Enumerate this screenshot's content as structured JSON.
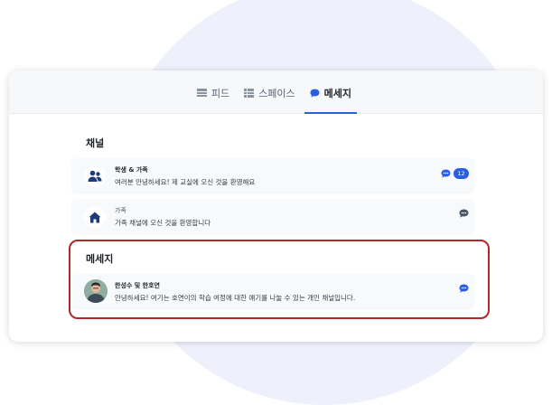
{
  "tabs": [
    {
      "label": "피드",
      "icon": "feed-icon"
    },
    {
      "label": "스페이스",
      "icon": "spaces-icon"
    },
    {
      "label": "메세지",
      "icon": "message-icon",
      "active": true
    }
  ],
  "channels": {
    "title": "채널",
    "items": [
      {
        "title": "학생 & 가족",
        "subtitle": "여러분 안녕하세요! 제 교실에 오신 것을 환영해요",
        "icon": "people-icon",
        "badge": "12"
      },
      {
        "title": "가족",
        "subtitle": "가족 채널에 오신 것을 환영합니다",
        "icon": "home-icon"
      }
    ]
  },
  "messages": {
    "title": "메세지",
    "items": [
      {
        "title": "한성수 및 한호연",
        "subtitle": "안녕하세요! 여기는 호연이의 학습 여정에 대한 얘기를 나눌 수 있는 개인 채널입니다.",
        "icon": "avatar"
      }
    ]
  },
  "colors": {
    "accent": "#2b5fe0",
    "highlight": "#b3262a"
  }
}
